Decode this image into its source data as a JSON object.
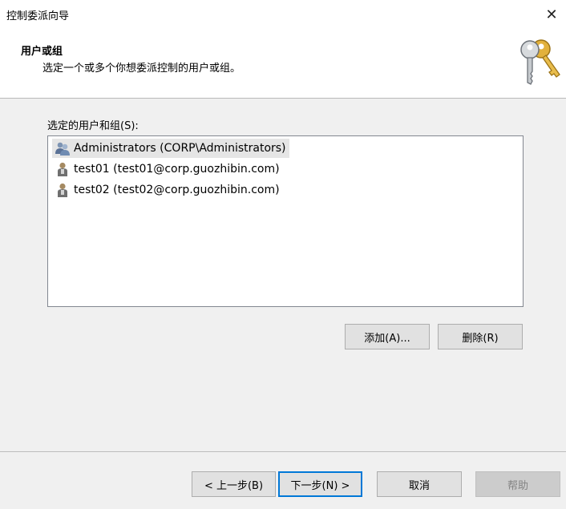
{
  "window": {
    "title": "控制委派向导",
    "close_glyph": "✕"
  },
  "header": {
    "title": "用户或组",
    "subtitle": "选定一个或多个你想委派控制的用户或组。",
    "icon": "keys-icon"
  },
  "list": {
    "label": "选定的用户和组(S):",
    "items": [
      {
        "text": "Administrators (CORP\\Administrators)",
        "icon": "group-icon",
        "selected": true
      },
      {
        "text": "test01 (test01@corp.guozhibin.com)",
        "icon": "user-icon",
        "selected": false
      },
      {
        "text": "test02 (test02@corp.guozhibin.com)",
        "icon": "user-icon",
        "selected": false
      }
    ]
  },
  "buttons": {
    "add": "添加(A)...",
    "remove": "删除(R)",
    "back": "< 上一步(B)",
    "next": "下一步(N) >",
    "cancel": "取消",
    "help": "帮助"
  },
  "colors": {
    "focus_border": "#0078d7",
    "list_selection": "#e5e5e5",
    "disabled_text": "#838383"
  }
}
